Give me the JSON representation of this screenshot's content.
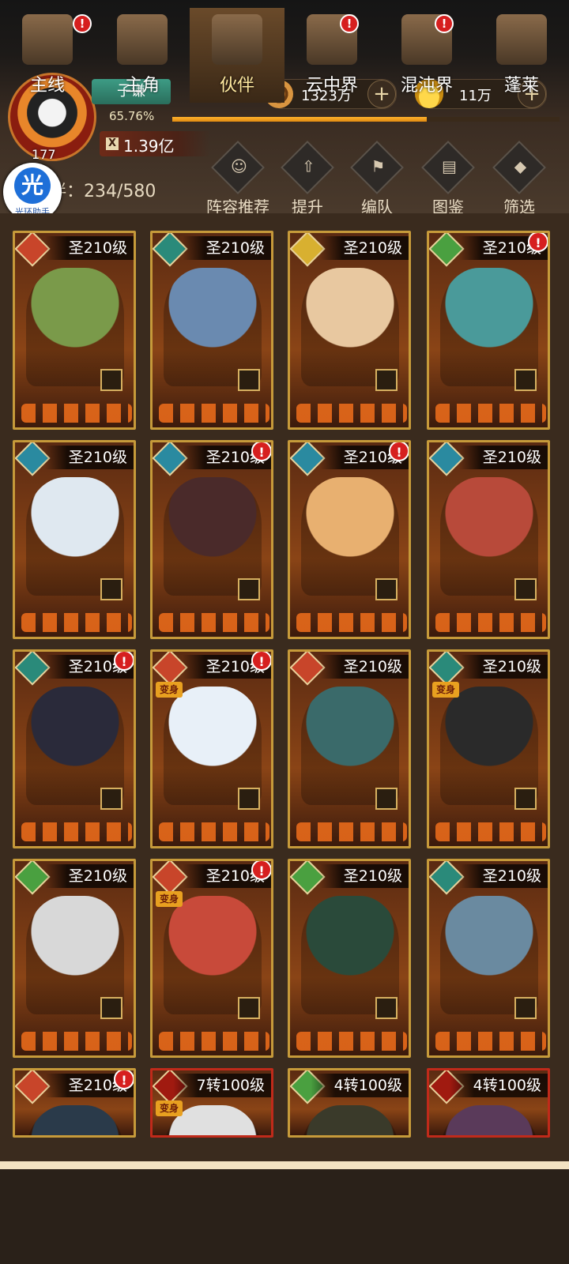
{
  "player": {
    "name": "子谦",
    "level": "177",
    "exp_percent": "65.76%",
    "exp_fraction": 0.6576,
    "power": "1.39亿"
  },
  "resources": {
    "coins": "1323万",
    "ingots": "11万"
  },
  "helper": {
    "glyph": "光",
    "label": "光环助手"
  },
  "partner_count": "伴：234/580",
  "actions": [
    {
      "label": "阵容推荐",
      "icon": "formation-recommend-icon"
    },
    {
      "label": "提升",
      "icon": "upgrade-icon"
    },
    {
      "label": "编队",
      "icon": "team-formation-icon"
    },
    {
      "label": "图鉴",
      "icon": "codex-icon"
    },
    {
      "label": "筛选",
      "icon": "filter-icon"
    }
  ],
  "cards": [
    {
      "level": "圣210级",
      "alert": false,
      "badge": ""
    },
    {
      "level": "圣210级",
      "alert": false,
      "badge": ""
    },
    {
      "level": "圣210级",
      "alert": false,
      "badge": ""
    },
    {
      "level": "圣210级",
      "alert": true,
      "badge": ""
    },
    {
      "level": "圣210级",
      "alert": false,
      "badge": ""
    },
    {
      "level": "圣210级",
      "alert": true,
      "badge": ""
    },
    {
      "level": "圣210级",
      "alert": true,
      "badge": ""
    },
    {
      "level": "圣210级",
      "alert": false,
      "badge": ""
    },
    {
      "level": "圣210级",
      "alert": true,
      "badge": ""
    },
    {
      "level": "圣210级",
      "alert": true,
      "badge": "变身"
    },
    {
      "level": "圣210级",
      "alert": false,
      "badge": ""
    },
    {
      "level": "圣210级",
      "alert": false,
      "badge": "变身"
    },
    {
      "level": "圣210级",
      "alert": false,
      "badge": ""
    },
    {
      "level": "圣210级",
      "alert": true,
      "badge": "变身"
    },
    {
      "level": "圣210级",
      "alert": false,
      "badge": ""
    },
    {
      "level": "圣210级",
      "alert": false,
      "badge": ""
    },
    {
      "level": "圣210级",
      "alert": true,
      "badge": ""
    },
    {
      "level": "7转100级",
      "alert": false,
      "badge": "变身"
    },
    {
      "level": "4转100级",
      "alert": false,
      "badge": ""
    },
    {
      "level": "4转100级",
      "alert": false,
      "badge": ""
    }
  ],
  "nav": [
    {
      "label": "主线",
      "alert": true,
      "active": false
    },
    {
      "label": "主角",
      "alert": false,
      "active": false
    },
    {
      "label": "伙伴",
      "alert": false,
      "active": true
    },
    {
      "label": "云中界",
      "alert": true,
      "active": false
    },
    {
      "label": "混沌界",
      "alert": true,
      "active": false
    },
    {
      "label": "蓬莱",
      "alert": false,
      "active": false
    }
  ],
  "alert_glyph": "!",
  "plus_glyph": "+",
  "power_glyph": "X"
}
